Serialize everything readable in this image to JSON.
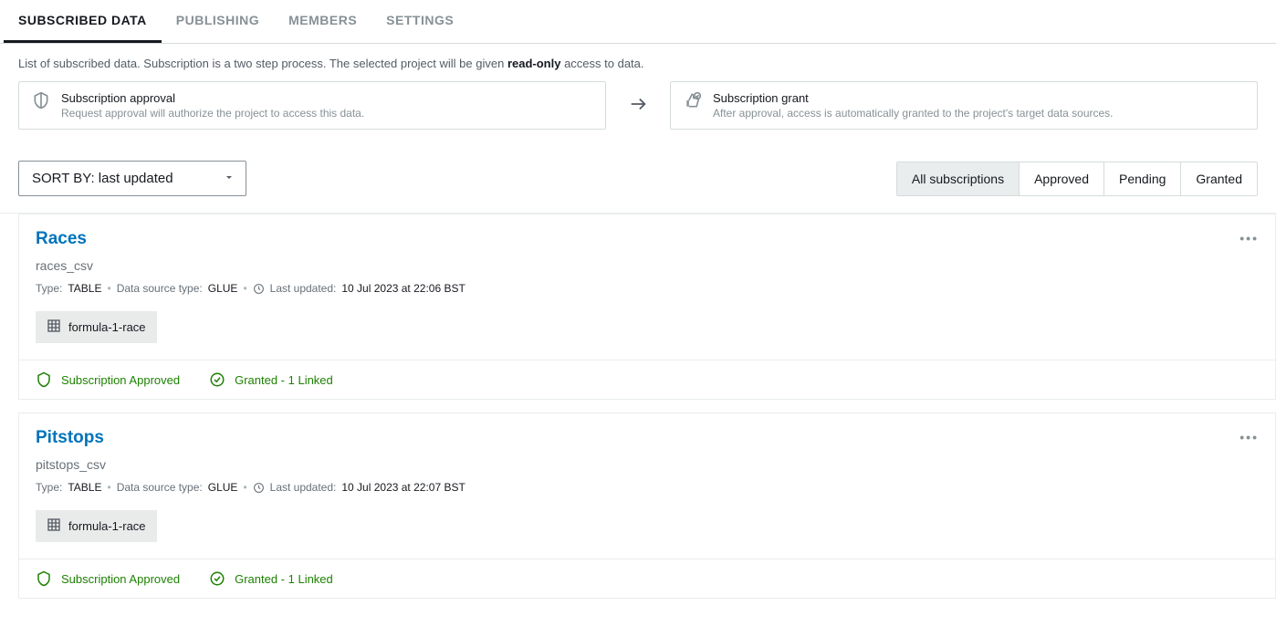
{
  "tabs": {
    "items": [
      {
        "label": "SUBSCRIBED DATA",
        "active": true
      },
      {
        "label": "PUBLISHING",
        "active": false
      },
      {
        "label": "MEMBERS",
        "active": false
      },
      {
        "label": "SETTINGS",
        "active": false
      }
    ]
  },
  "intro": {
    "prefix": "List of subscribed data. Subscription is a two step process. The selected project will be given ",
    "strong": "read-only",
    "suffix": " access to data."
  },
  "flow": {
    "step1_title": "Subscription approval",
    "step1_desc": "Request approval will authorize the project to access this data.",
    "step2_title": "Subscription grant",
    "step2_desc": "After approval, access is automatically granted to the project's target data sources."
  },
  "sort": {
    "label": "SORT BY: last updated"
  },
  "filters": {
    "items": [
      {
        "label": "All subscriptions",
        "active": true
      },
      {
        "label": "Approved",
        "active": false
      },
      {
        "label": "Pending",
        "active": false
      },
      {
        "label": "Granted",
        "active": false
      }
    ]
  },
  "labels": {
    "type": "Type:",
    "source": "Data source type:",
    "updated": "Last updated:"
  },
  "items": [
    {
      "title": "Races",
      "subtitle": "races_csv",
      "type": "TABLE",
      "source": "GLUE",
      "updated": "10 Jul 2023 at 22:06 BST",
      "tag": "formula-1-race",
      "status1": "Subscription Approved",
      "status2": "Granted - 1 Linked"
    },
    {
      "title": "Pitstops",
      "subtitle": "pitstops_csv",
      "type": "TABLE",
      "source": "GLUE",
      "updated": "10 Jul 2023 at 22:07 BST",
      "tag": "formula-1-race",
      "status1": "Subscription Approved",
      "status2": "Granted - 1 Linked"
    }
  ]
}
